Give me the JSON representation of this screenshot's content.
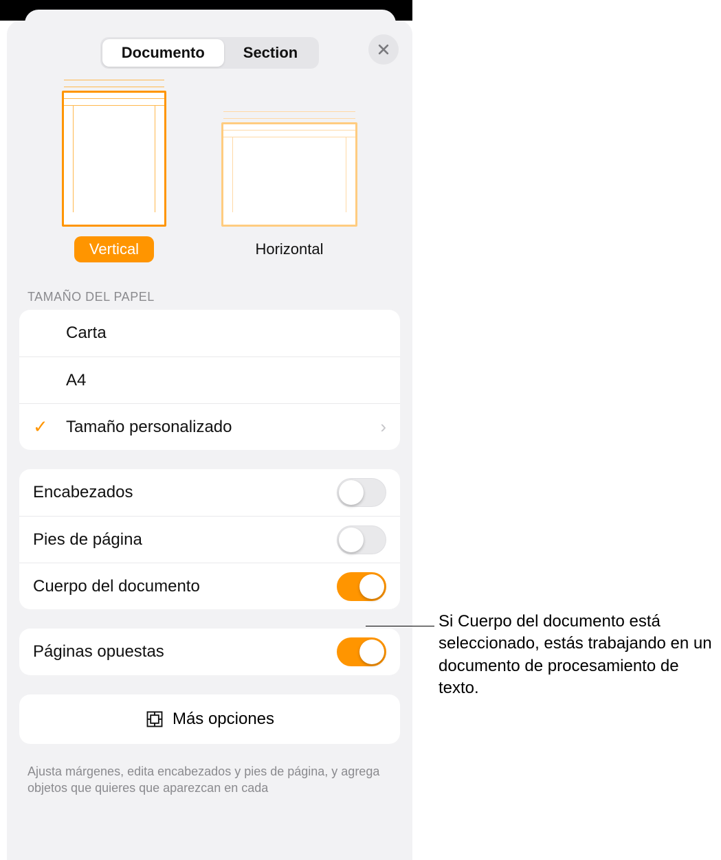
{
  "tabs": {
    "document": "Documento",
    "section": "Section"
  },
  "orientation": {
    "vertical": "Vertical",
    "horizontal": "Horizontal",
    "selected": "vertical"
  },
  "paper": {
    "section_title": "TAMAÑO DEL PAPEL",
    "options": {
      "letter": "Carta",
      "a4": "A4",
      "custom": "Tamaño personalizado"
    },
    "selected": "custom"
  },
  "toggles": {
    "headers": {
      "label": "Encabezados",
      "on": false
    },
    "footers": {
      "label": "Pies de página",
      "on": false
    },
    "body": {
      "label": "Cuerpo del documento",
      "on": true
    },
    "facing": {
      "label": "Páginas opuestas",
      "on": true
    }
  },
  "more_options": "Más opciones",
  "footer_note": "Ajusta márgenes, edita encabezados y pies de página, y agrega objetos que quieres que aparezcan en cada",
  "callout": "Si Cuerpo del documento está seleccionado, estás trabajando en un documento de procesamiento de texto."
}
